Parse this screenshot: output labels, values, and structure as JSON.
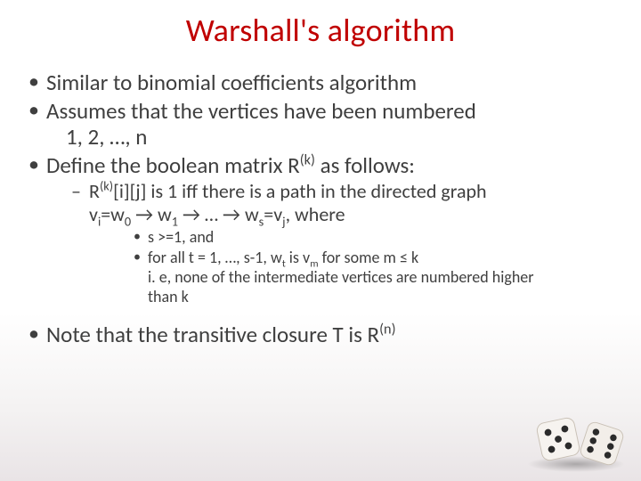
{
  "title": "Warshall's algorithm",
  "bullets": {
    "b1": "Similar to binomial coefficients algorithm",
    "b2a": "Assumes that the vertices have been numbered",
    "b2b": "1, 2, …, n",
    "b3a": "Define the boolean matrix R",
    "b3a_sup": "(k)",
    "b3b": " as follows:",
    "sub1a": "R",
    "sub1a_sup": "(k)",
    "sub1b": "[i][j] is 1 iff there is a path in the directed graph",
    "sub1c_pre": "v",
    "sub1c_i": "i",
    "sub1c_eq": "=w",
    "sub1c_0": "0",
    "sub1c_arr1": " → ",
    "sub1c_w1": "w",
    "sub1c_1": "1",
    "sub1c_arr2": " →  …  → ",
    "sub1c_ws": " w",
    "sub1c_s": "s",
    "sub1c_eq2": "=v",
    "sub1c_j": "j",
    "sub1c_tail": ",  where",
    "subsub1": "s >=1, and",
    "subsub2a": "for all  t = 1, …, s-1,  w",
    "subsub2a_t": "t",
    "subsub2b": "  is v",
    "subsub2b_m": "m",
    "subsub2c": " for some m ≤ k",
    "subsub3a": "i. e, none of the intermediate vertices are numbered higher",
    "subsub3b": "than k",
    "b4a": "Note that the transitive closure T is R",
    "b4_sup": "(n)"
  },
  "decoration": {
    "name": "dice-pair"
  }
}
